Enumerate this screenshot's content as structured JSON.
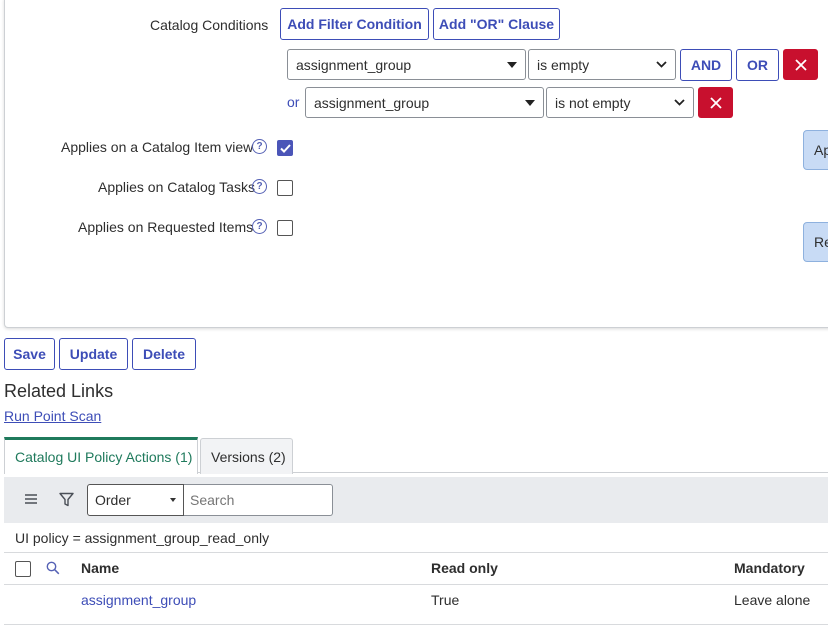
{
  "conditions": {
    "label": "Catalog Conditions",
    "add_filter_label": "Add Filter Condition",
    "add_or_label": "Add \"OR\" Clause",
    "row1": {
      "field": "assignment_group",
      "operator": "is empty",
      "and_label": "AND",
      "or_label": "OR"
    },
    "row2": {
      "prefix": "or",
      "field": "assignment_group",
      "operator": "is not empty"
    }
  },
  "applies": {
    "catalog_item_view": {
      "label": "Applies on a Catalog Item view",
      "checked": true
    },
    "catalog_tasks": {
      "label": "Applies on Catalog Tasks",
      "checked": false
    },
    "requested_items": {
      "label": "Applies on Requested Items",
      "checked": false
    }
  },
  "side_buttons": {
    "top_label": "Ap",
    "bottom_label": "Re"
  },
  "form_actions": {
    "save_label": "Save",
    "update_label": "Update",
    "delete_label": "Delete"
  },
  "related": {
    "heading": "Related Links",
    "run_point_scan": "Run Point Scan"
  },
  "tabs": [
    {
      "label": "Catalog UI Policy Actions (1)",
      "active": true
    },
    {
      "label": "Versions (2)",
      "active": false
    }
  ],
  "list": {
    "sort_field": "Order",
    "search_placeholder": "Search",
    "filter_breadcrumb": "UI policy = assignment_group_read_only",
    "columns": [
      "Name",
      "Read only",
      "Mandatory"
    ],
    "rows": [
      {
        "name": "assignment_group",
        "read_only": "True",
        "mandatory": "Leave alone"
      }
    ]
  },
  "colors": {
    "accent": "#3d4db7",
    "danger": "#c8102e",
    "active_tab": "#1f7a5c",
    "toolbar_bg": "#e9ebee"
  }
}
